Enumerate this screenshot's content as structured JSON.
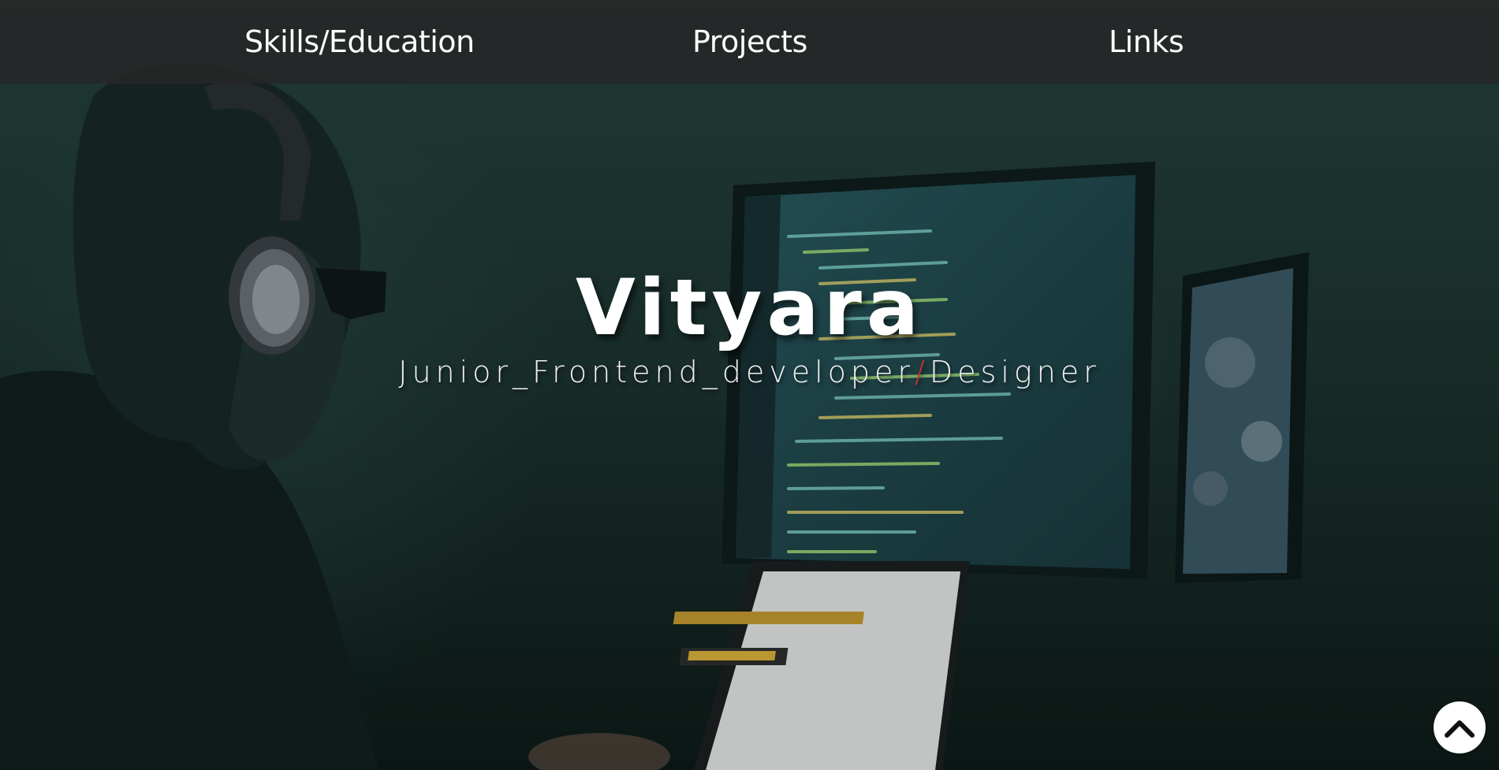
{
  "nav": {
    "items": [
      {
        "label": "Skills/Education"
      },
      {
        "label": "Projects"
      },
      {
        "label": "Links"
      }
    ]
  },
  "hero": {
    "title": "Vityara",
    "subtitle_role": "Junior_Frontend_developer",
    "subtitle_separator": "/",
    "subtitle_role2": "Designer"
  },
  "icons": {
    "scroll_top": "chevron-up-icon"
  },
  "colors": {
    "navbar": "#262626",
    "text": "#ffffff",
    "separator": "#c83232",
    "scroll_button": "#ffffff"
  }
}
